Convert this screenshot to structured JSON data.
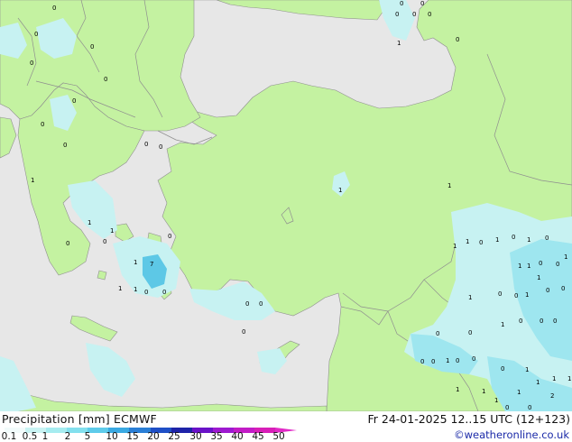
{
  "title_left": "Precipitation [mm]  ECMWF",
  "title_right": "Fr 24-01-2025 12..15 UTC (12+123)",
  "credit": "©weatheronline.co.uk",
  "scale": {
    "ticks": [
      "0.1",
      "0.5",
      "1",
      "2",
      "5",
      "10",
      "15",
      "20",
      "25",
      "30",
      "35",
      "40",
      "45",
      "50"
    ],
    "colors": [
      "#f2fbfb",
      "#c9f3f3",
      "#a6ecf0",
      "#83e0ee",
      "#5ecbea",
      "#3aa9e2",
      "#2a7ed6",
      "#1f4fc6",
      "#1e23a8",
      "#6a12c8",
      "#9d19d0",
      "#c21cc6",
      "#d81fb8",
      "#e12ac6"
    ]
  },
  "map": {
    "sea_color": "#e7e7e7",
    "land_color": "#c4f2a1",
    "border_color": "#8f8f8f",
    "precip_light": "#c7f2f2",
    "precip_mid": "#9ee6ef",
    "precip_heavy": "#5dc8e6",
    "labels": [
      "0",
      "0",
      "0",
      "1",
      "0",
      "0",
      "0",
      "0",
      "0",
      "0",
      "0",
      "0",
      "1",
      "0",
      "0",
      "0",
      "0",
      "1",
      "1",
      "0",
      "7",
      "1",
      "1",
      "1",
      "0",
      "0",
      "0",
      "0",
      "0",
      "0",
      "1",
      "1",
      "1",
      "1",
      "0",
      "1",
      "0",
      "1",
      "0",
      "1",
      "1",
      "1",
      "0",
      "0",
      "1",
      "0",
      "0",
      "1",
      "0",
      "0",
      "1",
      "1",
      "0",
      "0",
      "0",
      "0",
      "0",
      "1",
      "0",
      "0",
      "1",
      "0",
      "1",
      "1",
      "1",
      "1",
      "2",
      "1",
      "1",
      "1",
      "0",
      "0",
      "0",
      "0",
      "0",
      "0"
    ]
  }
}
